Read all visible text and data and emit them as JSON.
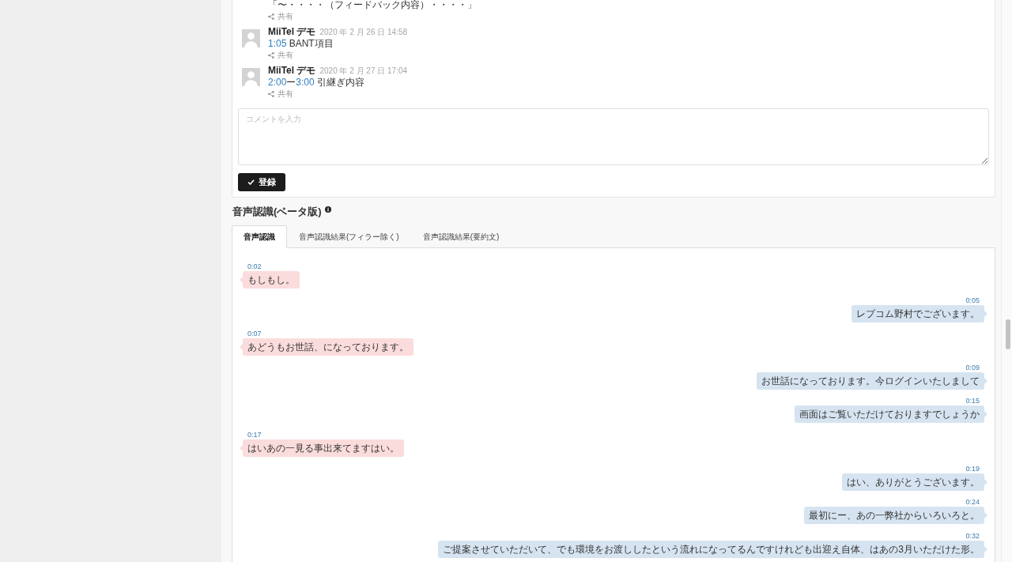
{
  "comments": {
    "partial_comment": {
      "text": "「〜・・・・（フィードバック内容）・・・・」",
      "share": "共有"
    },
    "items": [
      {
        "author": "MiiTel デモ",
        "date": "2020 年 2 月 26 日 14:58",
        "body": [
          {
            "kind": "link",
            "text": "1:05"
          },
          {
            "kind": "text",
            "text": " BANT項目"
          }
        ],
        "share": "共有"
      },
      {
        "author": "MiiTel デモ",
        "date": "2020 年 2 月 27 日 17:04",
        "body": [
          {
            "kind": "link",
            "text": "2:00"
          },
          {
            "kind": "text",
            "text": "ー"
          },
          {
            "kind": "link",
            "text": "3:00"
          },
          {
            "kind": "text",
            "text": " 引継ぎ内容"
          }
        ],
        "share": "共有"
      }
    ],
    "input": {
      "placeholder": "コメントを入力"
    },
    "submit_button": "登録"
  },
  "speech_recognition": {
    "title": "音声認識(ベータ版)",
    "tabs": [
      {
        "label": "音声認識",
        "selected": true
      },
      {
        "label": "音声認識結果(フィラー除く)",
        "selected": false
      },
      {
        "label": "音声認識結果(要約文)",
        "selected": false
      }
    ],
    "messages": [
      {
        "time": "0:02",
        "text": "もしもし。",
        "kind": "incoming"
      },
      {
        "time": "0:05",
        "text": "レブコム野村でございます。",
        "kind": "outgoing"
      },
      {
        "time": "0:07",
        "text": "あどうもお世話、になっております。",
        "kind": "incoming"
      },
      {
        "time": "0:09",
        "text": "お世話になっております。今ログインいたしまして",
        "kind": "outgoing"
      },
      {
        "time": "0:15",
        "text": "画面はご覧いただけておりますでしょうか",
        "kind": "outgoing"
      },
      {
        "time": "0:17",
        "text": "はいあの一見る事出来てますはい。",
        "kind": "incoming"
      },
      {
        "time": "0:19",
        "text": "はい、ありがとうございます。",
        "kind": "outgoing"
      },
      {
        "time": "0:24",
        "text": "最初にー、あの一弊社からいろいろと。",
        "kind": "outgoing"
      },
      {
        "time": "0:32",
        "text": "ご提案させていただいて、でも環境をお渡ししたという流れになってるんですけれども出迎え自体、はあの3月いただけた形。",
        "kind": "outgoing"
      }
    ]
  }
}
